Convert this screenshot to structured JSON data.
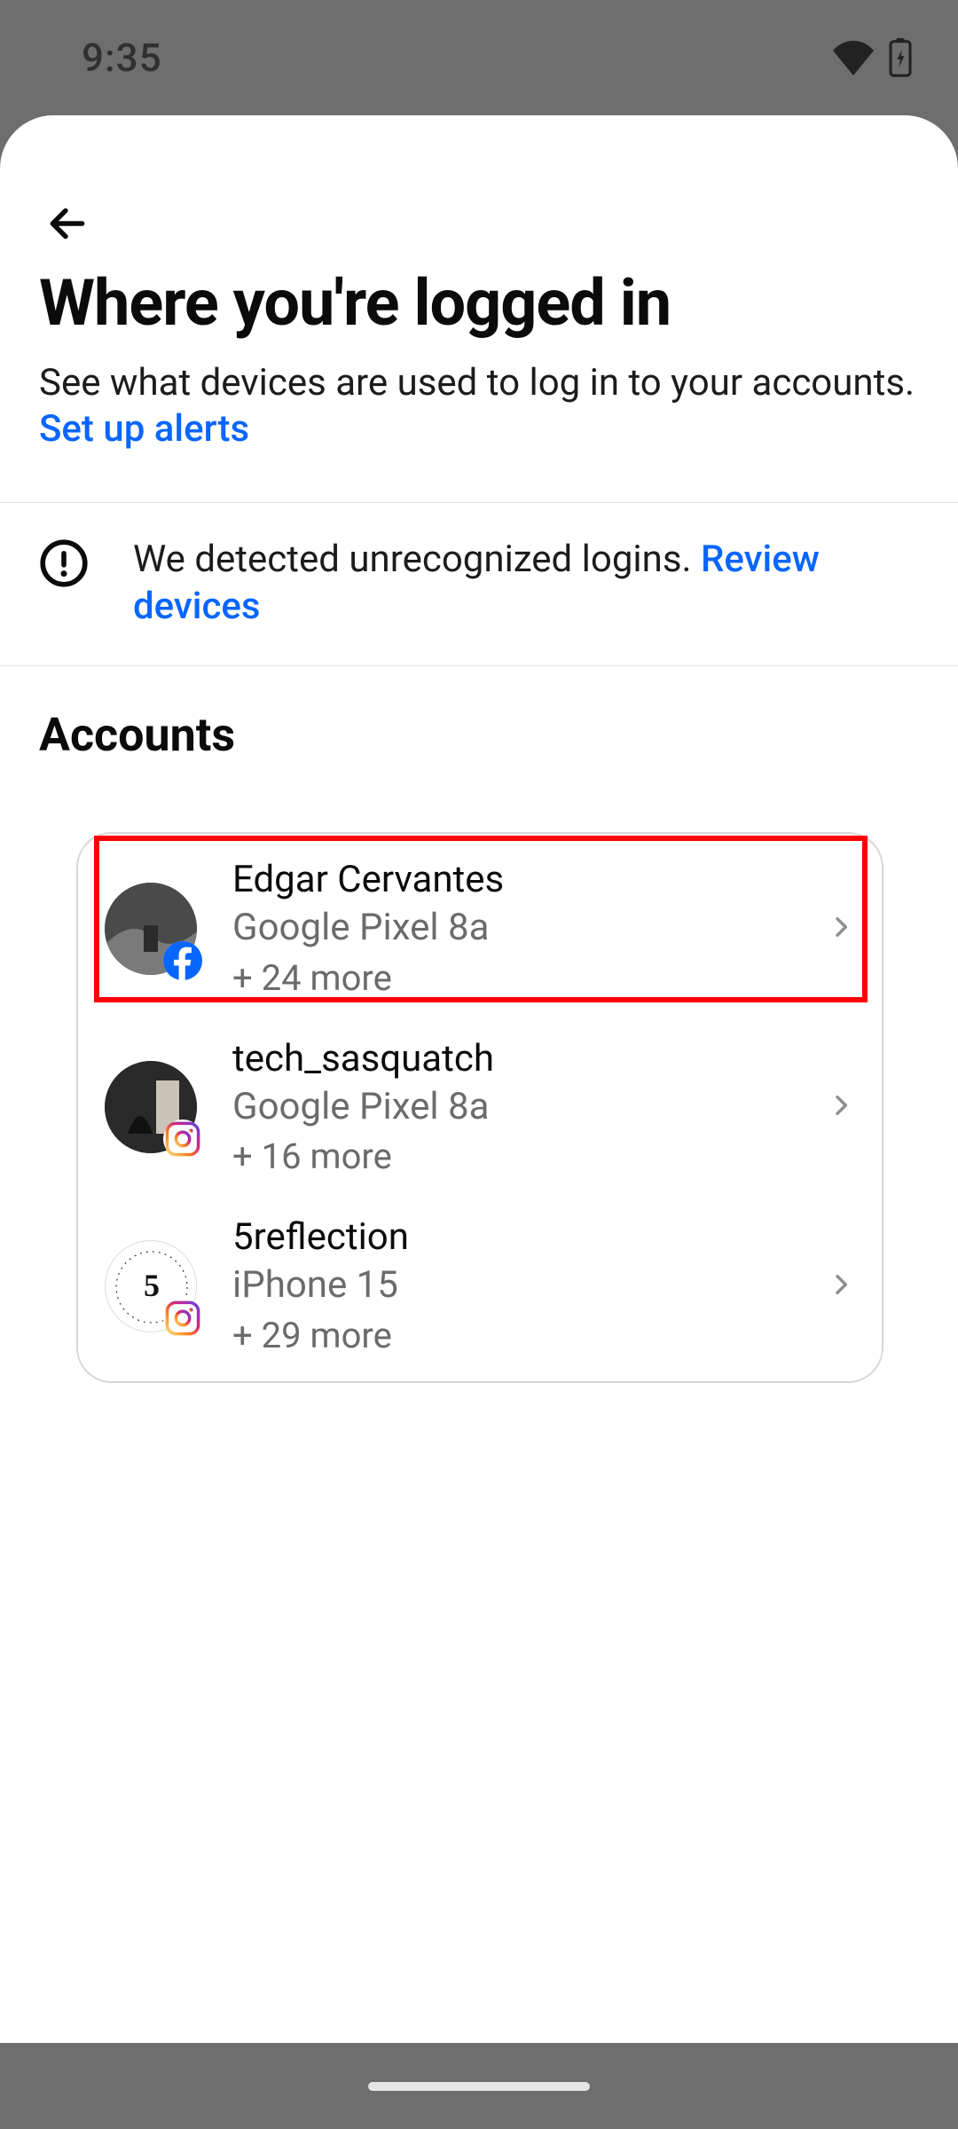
{
  "status": {
    "time": "9:35"
  },
  "header": {
    "title": "Where you're logged in",
    "subtitle": "See what devices are used to log in to your accounts.",
    "alerts_link": "Set up alerts"
  },
  "alert": {
    "text": "We detected unrecognized logins. ",
    "link": "Review devices"
  },
  "accounts_heading": "Accounts",
  "accounts": [
    {
      "name": "Edgar Cervantes",
      "device": "Google Pixel 8a",
      "more": "+ 24 more",
      "platform": "facebook"
    },
    {
      "name": "tech_sasquatch",
      "device": "Google Pixel 8a",
      "more": "+ 16 more",
      "platform": "instagram"
    },
    {
      "name": "5reflection",
      "device": "iPhone 15",
      "more": "+ 29 more",
      "platform": "instagram"
    }
  ]
}
